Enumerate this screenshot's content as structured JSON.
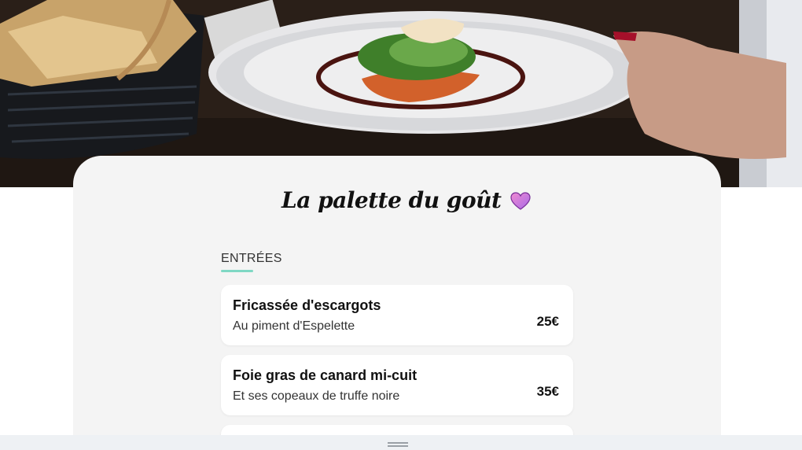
{
  "restaurant": {
    "title": "La palette du goût"
  },
  "icons": {
    "heart": "heart-icon",
    "grip": "drag-handle-icon"
  },
  "colors": {
    "accent": "#7fd8c4",
    "card_background": "#f4f4f4",
    "heart": "#c77be8"
  },
  "menu": {
    "section_label": "ENTRÉES",
    "items": [
      {
        "name": "Fricassée d'escargots",
        "description": "Au piment d'Espelette",
        "price": "25€"
      },
      {
        "name": "Foie gras de canard mi-cuit",
        "description": "Et ses copeaux de truffe noire",
        "price": "35€"
      }
    ]
  }
}
